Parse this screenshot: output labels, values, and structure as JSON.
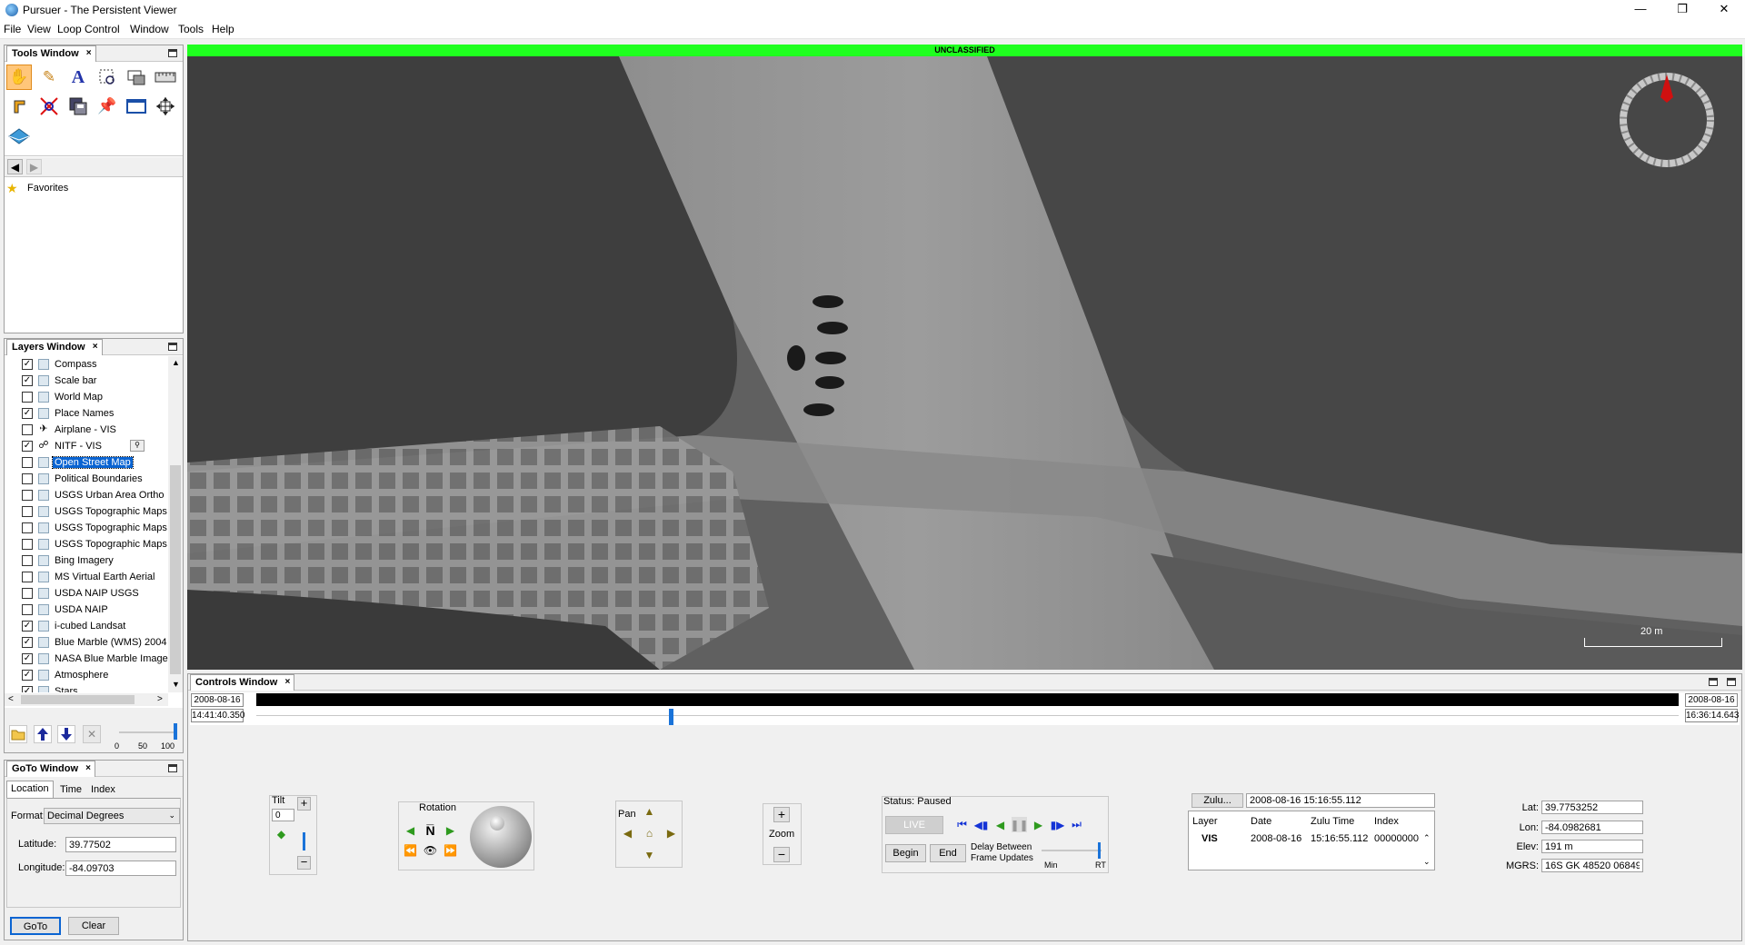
{
  "window": {
    "title": "Pursuer - The Persistent Viewer"
  },
  "menu": [
    "File",
    "View",
    "Loop Control",
    "Window",
    "Tools",
    "Help"
  ],
  "classification": "UNCLASSIFIED",
  "tools_window": {
    "title": "Tools Window",
    "icons": [
      "pan-hand-icon",
      "pencil-icon",
      "text-icon",
      "zoom-box-icon",
      "screenshot-icon",
      "ruler-icon",
      "label-icon",
      "intersect-icon",
      "save-frames-icon",
      "pin-icon",
      "rectangle-icon",
      "move-icon",
      "terrain-icon"
    ],
    "favorites_label": "Favorites"
  },
  "layers_window": {
    "title": "Layers Window",
    "layers": [
      {
        "name": "Compass",
        "checked": true,
        "icon": "layer-icon"
      },
      {
        "name": "Scale bar",
        "checked": true,
        "icon": "layer-icon"
      },
      {
        "name": "World Map",
        "checked": false,
        "icon": "layer-icon"
      },
      {
        "name": "Place Names",
        "checked": true,
        "icon": "layer-icon"
      },
      {
        "name": "Airplane - VIS",
        "checked": false,
        "icon": "airplane-icon"
      },
      {
        "name": "NITF - VIS",
        "checked": true,
        "icon": "satellite-icon"
      },
      {
        "name": "Open Street Map",
        "checked": false,
        "icon": "layer-icon",
        "selected": true
      },
      {
        "name": "Political Boundaries",
        "checked": false,
        "icon": "layer-icon"
      },
      {
        "name": "USGS Urban Area Ortho",
        "checked": false,
        "icon": "layer-icon"
      },
      {
        "name": "USGS Topographic Maps",
        "checked": false,
        "icon": "layer-icon"
      },
      {
        "name": "USGS Topographic Maps",
        "checked": false,
        "icon": "layer-icon"
      },
      {
        "name": "USGS Topographic Maps",
        "checked": false,
        "icon": "layer-icon"
      },
      {
        "name": "Bing Imagery",
        "checked": false,
        "icon": "layer-icon"
      },
      {
        "name": "MS Virtual Earth Aerial",
        "checked": false,
        "icon": "layer-icon"
      },
      {
        "name": "USDA NAIP USGS",
        "checked": false,
        "icon": "layer-icon"
      },
      {
        "name": "USDA NAIP",
        "checked": false,
        "icon": "layer-icon"
      },
      {
        "name": "i-cubed Landsat",
        "checked": true,
        "icon": "layer-icon"
      },
      {
        "name": "Blue Marble (WMS) 2004",
        "checked": true,
        "icon": "layer-icon"
      },
      {
        "name": "NASA Blue Marble Image",
        "checked": true,
        "icon": "layer-icon"
      },
      {
        "name": "Atmosphere",
        "checked": true,
        "icon": "layer-icon"
      },
      {
        "name": "Stars",
        "checked": true,
        "icon": "layer-icon"
      }
    ],
    "opacity_ticks": [
      "0",
      "50",
      "100"
    ],
    "opacity_value": 1.0
  },
  "goto_window": {
    "title": "GoTo Window",
    "tabs": [
      "Location",
      "Time",
      "Index"
    ],
    "format_label": "Format:",
    "format_value": "Decimal Degrees",
    "latitude_label": "Latitude:",
    "latitude_value": "39.77502",
    "longitude_label": "Longitude:",
    "longitude_value": "-84.09703",
    "goto_button": "GoTo",
    "clear_button": "Clear"
  },
  "viewer": {
    "scale_label": "20 m"
  },
  "controls_window": {
    "title": "Controls Window",
    "timeline": {
      "start_date": "2008-08-16",
      "start_time": "14:41:40.350",
      "end_date": "2008-08-16",
      "end_time": "16:36:14.643",
      "position": 0.29
    },
    "tilt_label": "Tilt",
    "tilt_value": "0",
    "rotation_label": "Rotation",
    "pan_label": "Pan",
    "zoom_label": "Zoom",
    "status_label": "Status: Paused",
    "live_button": "LIVE",
    "begin_button": "Begin",
    "end_button": "End",
    "delay_label_1": "Delay Between",
    "delay_label_2": "Frame Updates",
    "delay_min": "Min",
    "delay_max": "RT",
    "zulu_button": "Zulu...",
    "zulu_value": "2008-08-16 15:16:55.112",
    "frame_table": {
      "headers": [
        "Layer",
        "Date",
        "Zulu Time",
        "Index"
      ],
      "row": [
        "VIS",
        "2008-08-16",
        "15:16:55.112",
        "00000000"
      ]
    },
    "coords": {
      "lat_label": "Lat:",
      "lat_value": "39.7753252",
      "lon_label": "Lon:",
      "lon_value": "-84.0982681",
      "elev_label": "Elev:",
      "elev_value": "191 m",
      "mgrs_label": "MGRS:",
      "mgrs_value": "16S GK 48520 06849"
    }
  }
}
